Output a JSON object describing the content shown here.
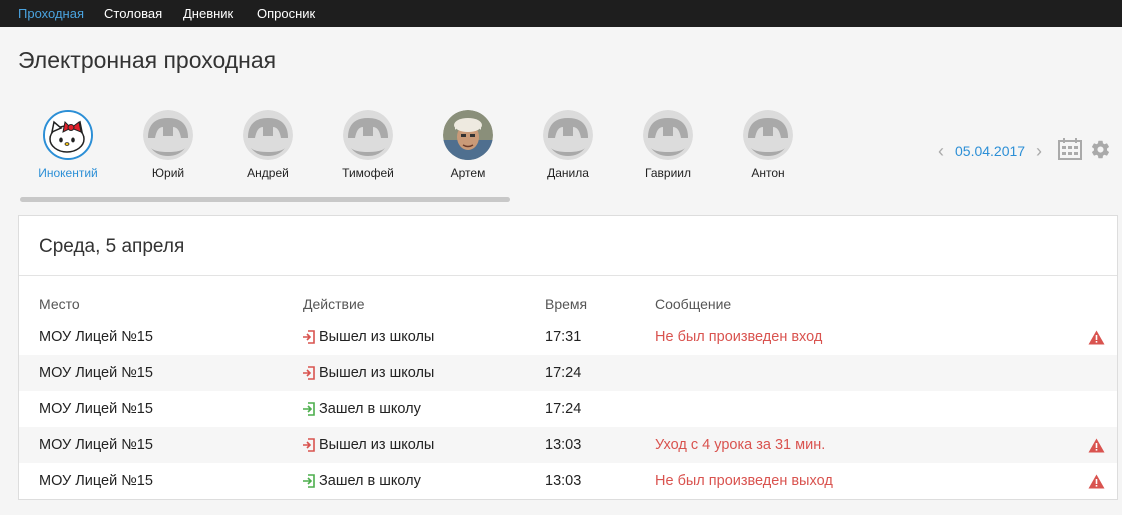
{
  "nav": {
    "items": [
      "Проходная",
      "Столовая",
      "Дневник",
      "Опросник"
    ]
  },
  "page": {
    "title": "Электронная проходная"
  },
  "students": [
    {
      "name": "Инокентий",
      "avatar": "hello-kitty"
    },
    {
      "name": "Юрий",
      "avatar": "placeholder"
    },
    {
      "name": "Андрей",
      "avatar": "placeholder"
    },
    {
      "name": "Тимофей",
      "avatar": "placeholder"
    },
    {
      "name": "Артем",
      "avatar": "photo"
    },
    {
      "name": "Данила",
      "avatar": "placeholder"
    },
    {
      "name": "Гавриил",
      "avatar": "placeholder"
    },
    {
      "name": "Антон",
      "avatar": "placeholder"
    }
  ],
  "date": {
    "value": "05.04.2017",
    "prev": "‹",
    "next": "›"
  },
  "panel": {
    "heading": "Среда, 5 апреля",
    "columns": [
      "Место",
      "Действие",
      "Время",
      "Сообщение"
    ],
    "rows": [
      {
        "place": "МОУ Лицей №15",
        "action": "Вышел из школы",
        "action_type": "exit",
        "time": "17:31",
        "message": "Не был произведен вход",
        "warning": true
      },
      {
        "place": "МОУ Лицей №15",
        "action": "Вышел из школы",
        "action_type": "exit",
        "time": "17:24",
        "message": "",
        "warning": false
      },
      {
        "place": "МОУ Лицей №15",
        "action": "Зашел в школу",
        "action_type": "enter",
        "time": "17:24",
        "message": "",
        "warning": false
      },
      {
        "place": "МОУ Лицей №15",
        "action": "Вышел из школы",
        "action_type": "exit",
        "time": "13:03",
        "message": "Уход с 4 урока за 31 мин.",
        "warning": true
      },
      {
        "place": "МОУ Лицей №15",
        "action": "Зашел в школу",
        "action_type": "enter",
        "time": "13:03",
        "message": "Не был произведен выход",
        "warning": true
      }
    ]
  },
  "colors": {
    "accent": "#2c8fd6",
    "nav_active": "#4aa3df",
    "exit": "#d9534f",
    "enter": "#4cae4c",
    "alert": "#d9534f"
  }
}
